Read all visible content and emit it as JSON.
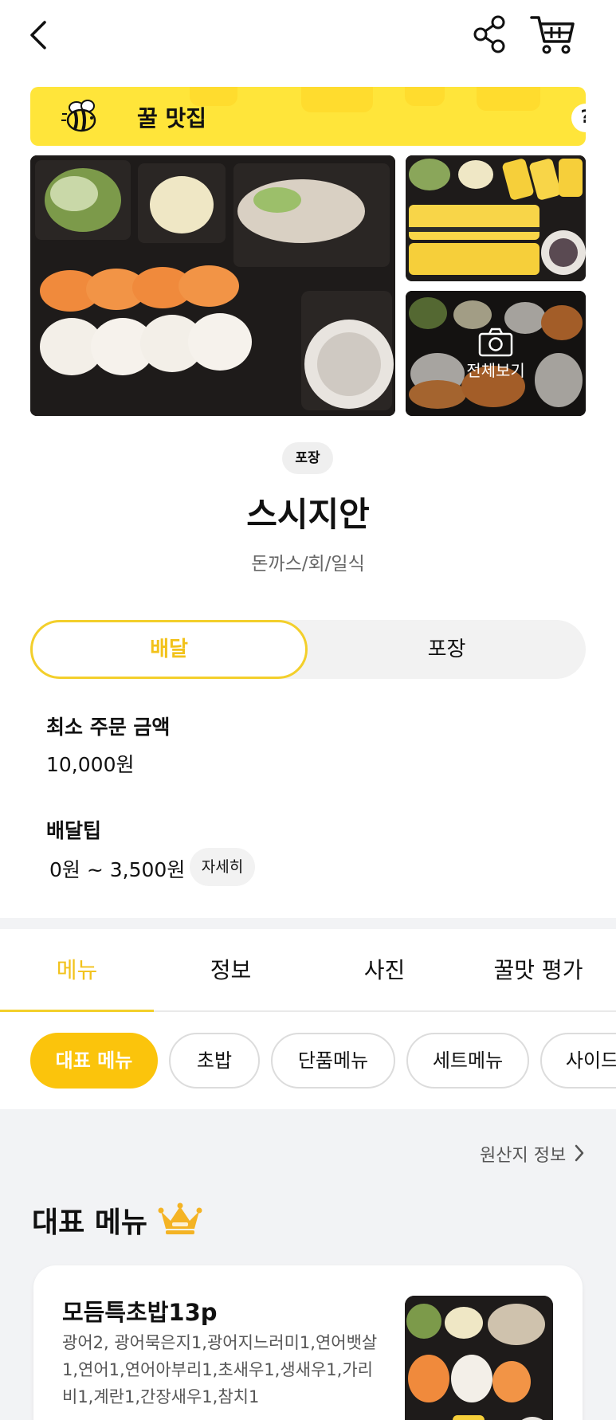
{
  "topbar": {
    "back_icon": "chevron-left-icon",
    "share_icon": "share-icon",
    "cart_icon": "cart-icon"
  },
  "banner": {
    "title": "꿀 맛집",
    "help": "?",
    "bg_color": "#ffe53a"
  },
  "photos": {
    "view_all_label": "전체보기"
  },
  "store": {
    "badge": "포장",
    "name": "스시지안",
    "category": "돈까스/회/일식"
  },
  "order_type": {
    "options": [
      "배달",
      "포장"
    ],
    "selected": "배달"
  },
  "info": {
    "min_order_label": "최소 주문 금액",
    "min_order_value": "10,000원",
    "delivery_tip_label": "배달팁",
    "delivery_tip_value": "0원 ~ 3,500원",
    "detail_button": "자세히"
  },
  "tabs": [
    "메뉴",
    "정보",
    "사진",
    "꿀맛 평가"
  ],
  "active_tab": "메뉴",
  "menu_categories": [
    "대표 메뉴",
    "초밥",
    "단품메뉴",
    "세트메뉴",
    "사이드"
  ],
  "active_category": "대표 메뉴",
  "origin_info": "원산지 정보",
  "section_title": "대표 메뉴",
  "menu_item": {
    "name": "모듬특초밥13p",
    "description": "광어2, 광어묵은지1,광어지느러미1,연어뱃살1,연어1,연어아부리1,초새우1,생새우1,가리비1,계란1,간장새우1,참치1"
  },
  "colors": {
    "accent": "#f2c21a",
    "chip_active": "#fbc40c",
    "banner": "#ffe53a"
  }
}
